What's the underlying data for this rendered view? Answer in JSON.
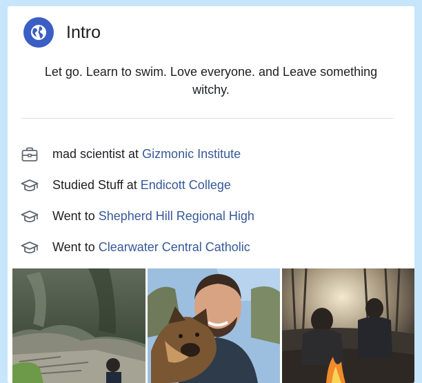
{
  "intro": {
    "title": "Intro",
    "header_icon": "globe-icon",
    "bio": "Let go. Learn to swim. Love everyone. and Leave something witchy."
  },
  "details": [
    {
      "icon": "briefcase-icon",
      "prefix": "mad scientist at",
      "link": "Gizmonic Institute"
    },
    {
      "icon": "graduation-cap-icon",
      "prefix": "Studied Stuff at",
      "link": "Endicott College"
    },
    {
      "icon": "graduation-cap-icon",
      "prefix": "Went to",
      "link": "Shepherd Hill Regional High"
    },
    {
      "icon": "graduation-cap-icon",
      "prefix": "Went to",
      "link": "Clearwater Central Catholic"
    }
  ],
  "colors": {
    "background": "#c8e6fb",
    "card": "#ffffff",
    "link": "#365899",
    "badge": "#3b5ec5"
  }
}
